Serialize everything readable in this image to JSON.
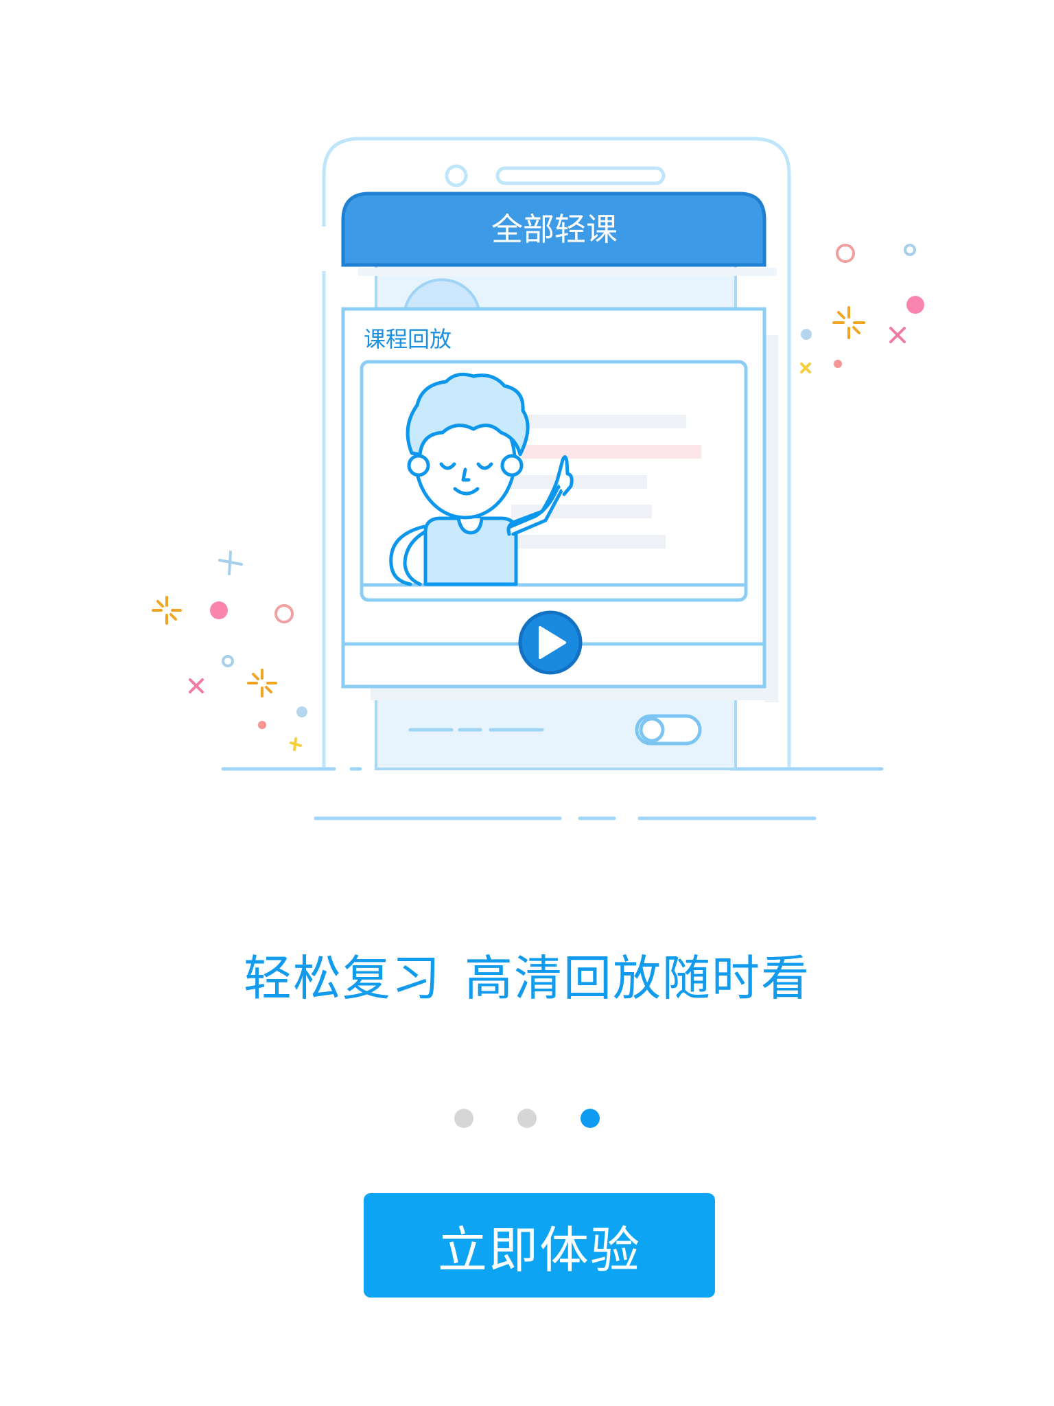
{
  "illustration": {
    "header_title": "全部轻课",
    "section_label": "课程回放",
    "icons": [
      "phone-outline",
      "teacher-character",
      "play-icon",
      "toggle-icon",
      "confetti-decorations"
    ]
  },
  "headline": {
    "part1": "轻松复习",
    "part2": "高清回放随时看"
  },
  "pagination": {
    "total": 3,
    "active_index": 2
  },
  "cta": {
    "label": "立即体验"
  },
  "colors": {
    "primary": "#0da5f3",
    "headline": "#129bec",
    "dot_inactive": "#d6d6d6",
    "dot_active": "#0f9bf0"
  }
}
